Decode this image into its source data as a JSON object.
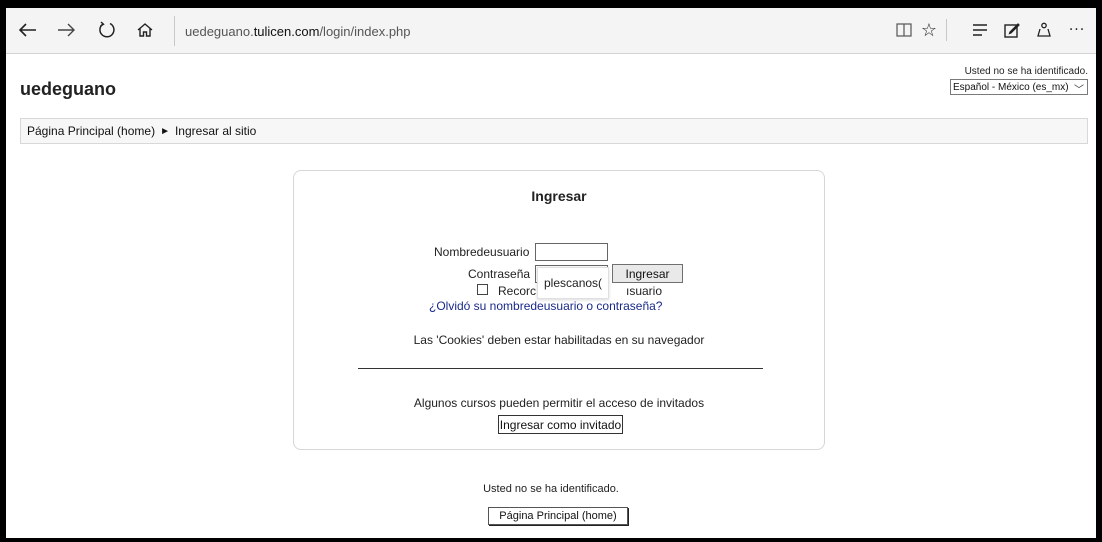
{
  "browser": {
    "url_prefix": "uedeguano.",
    "url_host": "tulicen.com",
    "url_path": "/login/index.php",
    "icons": [
      "back-icon",
      "forward-icon",
      "refresh-icon",
      "home-icon",
      "reading-view-icon",
      "favorite-star-icon",
      "hub-icon",
      "web-note-icon",
      "share-icon",
      "more-icon"
    ]
  },
  "header": {
    "site_title": "uedeguano",
    "ident_status": "Usted no se ha identificado.",
    "language_selected": "Español - México (es_mx)"
  },
  "breadcrumb": {
    "home": "Página Principal (home)",
    "separator": "►",
    "current": "Ingresar al sitio"
  },
  "login": {
    "heading": "Ingresar",
    "username_label": "Nombredeusuario",
    "username_value": "",
    "password_label": "Contraseña",
    "autocomplete_suggestion": "plescanos(",
    "login_button": "Ingresar",
    "remember_label_start": "Recorc",
    "remember_label_end": "ısuario",
    "forgot_link": "¿Olvidó su nombredeusuario o contraseña?",
    "cookies_notice": "Las 'Cookies' deben estar habilitadas en su navegador",
    "guest_notice": "Algunos cursos pueden permitir el acceso de invitados",
    "guest_button": "Ingresar como invitado"
  },
  "footer": {
    "ident_status": "Usted no se ha identificado.",
    "home_button": "Página Principal (home)"
  }
}
